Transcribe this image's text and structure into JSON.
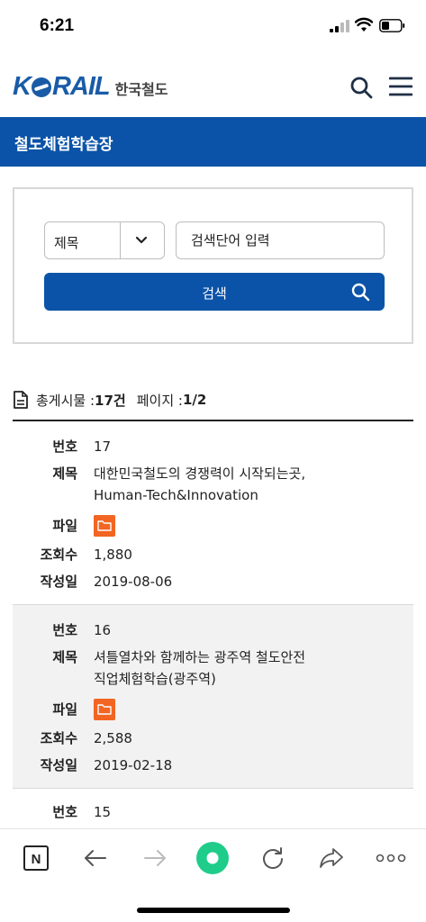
{
  "status": {
    "time": "6:21"
  },
  "header": {
    "logo_text": "KORAIL",
    "logo_sub": "한국철도"
  },
  "page": {
    "title": "철도체험학습장"
  },
  "search": {
    "select_value": "제목",
    "input_placeholder": "검색단어 입력",
    "button_label": "검색"
  },
  "summary": {
    "total_label": "총게시물 :",
    "total_value": "17건",
    "page_label": "페이지 :",
    "page_value": "1/2"
  },
  "labels": {
    "number": "번호",
    "title": "제목",
    "file": "파일",
    "views": "조회수",
    "date": "작성일"
  },
  "records": [
    {
      "number": "17",
      "title_line1": "대한민국철도의 경쟁력이 시작되는곳,",
      "title_line2": "Human-Tech&Innovation",
      "views": "1,880",
      "date": "2019-08-06"
    },
    {
      "number": "16",
      "title_line1": "셔틀열차와 함께하는 광주역 철도안전",
      "title_line2": "직업체험학습(광주역)",
      "views": "2,588",
      "date": "2019-02-18"
    },
    {
      "number": "15"
    }
  ],
  "colors": {
    "brand": "#0b53a8",
    "file_icon": "#f26522",
    "browser_accent": "#1fcc8a"
  },
  "icons": {
    "search": "search-icon",
    "menu": "hamburger-menu-icon",
    "chevron": "chevron-down-icon",
    "document": "document-icon",
    "folder": "folder-icon"
  }
}
